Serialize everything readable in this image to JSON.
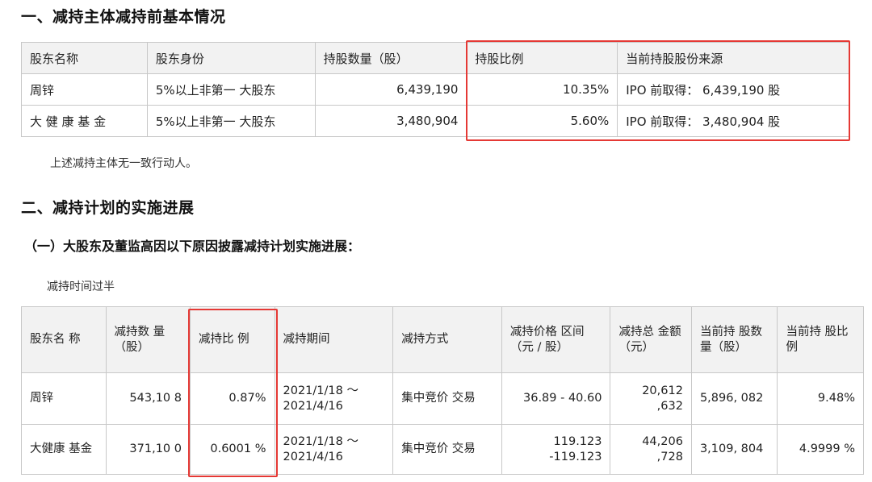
{
  "section1": {
    "heading": "一、减持主体减持前基本情况",
    "table": {
      "headers": [
        "股东名称",
        "股东身份",
        "持股数量（股）",
        "持股比例",
        "当前持股股份来源"
      ],
      "rows": [
        [
          "周锌",
          "5%以上非第一 大股东",
          "6,439,190",
          "10.35%",
          "IPO 前取得： 6,439,190 股"
        ],
        [
          "大 健 康 基 金",
          "5%以上非第一 大股东",
          "3,480,904",
          "5.60%",
          "IPO 前取得： 3,480,904 股"
        ]
      ]
    },
    "note": "上述减持主体无一致行动人。"
  },
  "section2": {
    "heading": "二、减持计划的实施进展",
    "subheading": "（一）大股东及董监高因以下原因披露减持计划实施进展：",
    "reason": "减持时间过半",
    "table": {
      "headers": [
        "股东名 称",
        "减持数 量（股）",
        "减持比 例",
        "减持期间",
        "减持方式",
        "减持价格 区间（元 / 股）",
        "减持总 金额（元）",
        "当前持 股数量（股）",
        "当前持 股比例"
      ],
      "rows": [
        [
          "周锌",
          "543,10 8",
          "0.87%",
          "2021/1/18 ～ 2021/4/16",
          "集中竞价 交易",
          "36.89 - 40.60",
          "20,612 ,632",
          "5,896, 082",
          "9.48%"
        ],
        [
          "大健康 基金",
          "371,10 0",
          "0.6001 %",
          "2021/1/18 ～ 2021/4/16",
          "集中竞价 交易",
          "119.123 -119.123",
          "44,206 ,728",
          "3,109, 804",
          "4.9999 %"
        ]
      ]
    }
  },
  "highlight_color": "#e53935"
}
